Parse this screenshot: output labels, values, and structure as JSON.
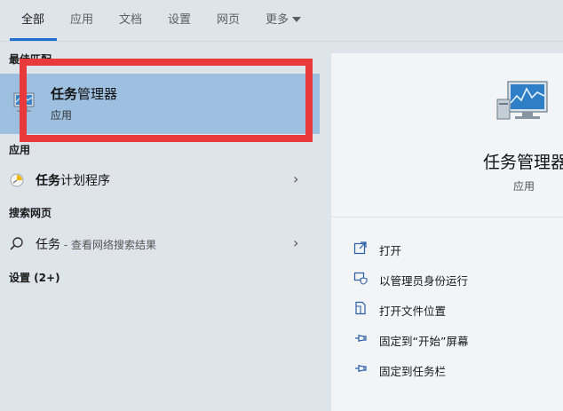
{
  "tabs": [
    {
      "label": "全部"
    },
    {
      "label": "应用"
    },
    {
      "label": "文档"
    },
    {
      "label": "设置"
    },
    {
      "label": "网页"
    },
    {
      "label": "更多"
    }
  ],
  "left": {
    "best_match_header": "最佳匹配",
    "best_match": {
      "title_bold": "任务",
      "title_rest": "管理器",
      "subtitle": "应用"
    },
    "apps_header": "应用",
    "app_item": {
      "label_bold": "任务",
      "label_rest": "计划程序"
    },
    "web_header": "搜索网页",
    "web_item": {
      "query": "任务",
      "hint": " - 查看网络搜索结果"
    },
    "settings_header": "设置 (2+)"
  },
  "right": {
    "title": "任务管理器",
    "subtitle": "应用",
    "actions": [
      {
        "label": "打开",
        "icon": "open-icon"
      },
      {
        "label": "以管理员身份运行",
        "icon": "shield-icon"
      },
      {
        "label": "打开文件位置",
        "icon": "folder-icon"
      },
      {
        "label": "固定到“开始”屏幕",
        "icon": "pin-icon"
      },
      {
        "label": "固定到任务栏",
        "icon": "pin-icon"
      }
    ]
  },
  "colors": {
    "accent": "#1f6fd1",
    "highlight": "#9dbfe0",
    "annotation_red": "#e8393b"
  }
}
